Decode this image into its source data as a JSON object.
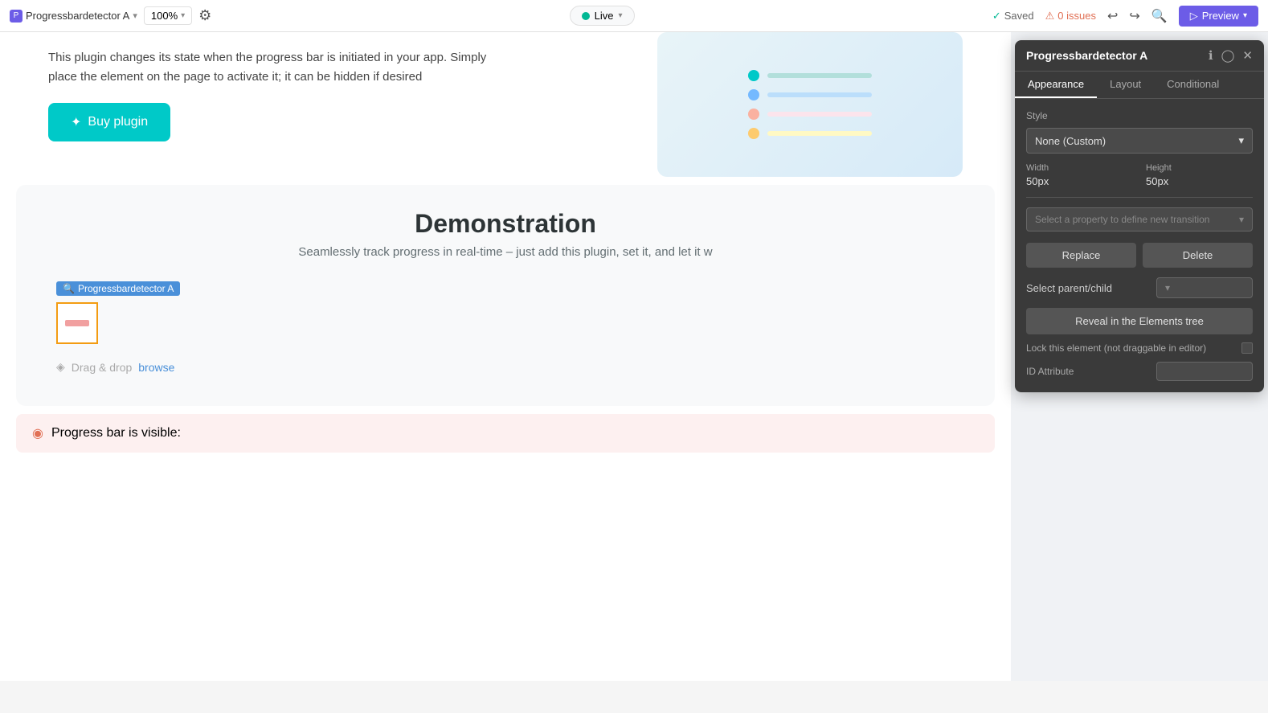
{
  "topbar": {
    "app_name": "Progressbardetector A",
    "app_icon": "P",
    "zoom": "100%",
    "live_label": "Live",
    "saved_label": "Saved",
    "issues_label": "0 issues",
    "undo_icon": "↩",
    "redo_icon": "↪",
    "search_icon": "🔍",
    "preview_label": "Preview",
    "preview_icon": "▷",
    "chevron_icon": "▾"
  },
  "hero": {
    "description": "This plugin changes its state when the progress bar is initiated in your app. Simply place the element on the page to activate it; it can be hidden if desired",
    "buy_button": "Buy plugin",
    "buy_icon": "✦"
  },
  "demo": {
    "title": "Demonstration",
    "subtitle": "Seamlessly track progress in real-time – just add this plugin, set it, and let it w"
  },
  "element": {
    "label": "Progressbardetector A",
    "search_icon": "🔍"
  },
  "drag_drop": {
    "text": "Drag & drop",
    "browse_link": "browse",
    "icon": "◈"
  },
  "progress_bar": {
    "text": "Progress bar is visible:",
    "icon": "◉"
  },
  "panel": {
    "title": "Progressbardetector A",
    "info_icon": "ℹ",
    "chat_icon": "◯",
    "close_icon": "✕",
    "tabs": [
      {
        "id": "appearance",
        "label": "Appearance",
        "active": true
      },
      {
        "id": "layout",
        "label": "Layout",
        "active": false
      },
      {
        "id": "conditional",
        "label": "Conditional",
        "active": false
      }
    ],
    "style_label": "Style",
    "style_value": "None (Custom)",
    "style_chevron": "▾",
    "width_label": "Width",
    "width_value": "50px",
    "height_label": "Height",
    "height_value": "50px",
    "transition_placeholder": "Select a property to define new transition",
    "transition_chevron": "▾",
    "replace_label": "Replace",
    "delete_label": "Delete",
    "parent_child_label": "Select parent/child",
    "parent_child_chevron": "▾",
    "reveal_btn": "Reveal in the Elements tree",
    "lock_label": "Lock this element (not draggable in editor)",
    "id_label": "ID Attribute",
    "id_value": ""
  }
}
